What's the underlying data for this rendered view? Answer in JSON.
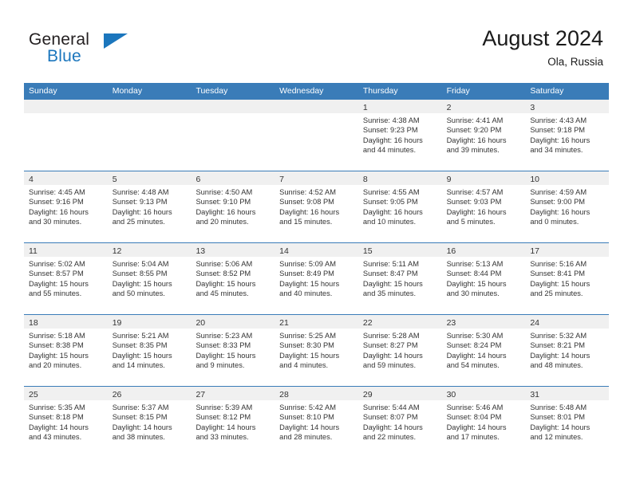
{
  "brand": {
    "name_part1": "General",
    "name_part2": "Blue",
    "flag_icon": "brand-flag-icon"
  },
  "header": {
    "title": "August 2024",
    "location": "Ola, Russia"
  },
  "weekday_headers": [
    "Sunday",
    "Monday",
    "Tuesday",
    "Wednesday",
    "Thursday",
    "Friday",
    "Saturday"
  ],
  "colors": {
    "header_blue": "#3a7cb8",
    "band_gray": "#f0f0f0",
    "brand_blue": "#1b76bd",
    "text": "#333333"
  },
  "weeks": [
    [
      {
        "empty": true
      },
      {
        "empty": true
      },
      {
        "empty": true
      },
      {
        "empty": true
      },
      {
        "day": "1",
        "sunrise": "Sunrise: 4:38 AM",
        "sunset": "Sunset: 9:23 PM",
        "daylight1": "Daylight: 16 hours",
        "daylight2": "and 44 minutes."
      },
      {
        "day": "2",
        "sunrise": "Sunrise: 4:41 AM",
        "sunset": "Sunset: 9:20 PM",
        "daylight1": "Daylight: 16 hours",
        "daylight2": "and 39 minutes."
      },
      {
        "day": "3",
        "sunrise": "Sunrise: 4:43 AM",
        "sunset": "Sunset: 9:18 PM",
        "daylight1": "Daylight: 16 hours",
        "daylight2": "and 34 minutes."
      }
    ],
    [
      {
        "day": "4",
        "sunrise": "Sunrise: 4:45 AM",
        "sunset": "Sunset: 9:16 PM",
        "daylight1": "Daylight: 16 hours",
        "daylight2": "and 30 minutes."
      },
      {
        "day": "5",
        "sunrise": "Sunrise: 4:48 AM",
        "sunset": "Sunset: 9:13 PM",
        "daylight1": "Daylight: 16 hours",
        "daylight2": "and 25 minutes."
      },
      {
        "day": "6",
        "sunrise": "Sunrise: 4:50 AM",
        "sunset": "Sunset: 9:10 PM",
        "daylight1": "Daylight: 16 hours",
        "daylight2": "and 20 minutes."
      },
      {
        "day": "7",
        "sunrise": "Sunrise: 4:52 AM",
        "sunset": "Sunset: 9:08 PM",
        "daylight1": "Daylight: 16 hours",
        "daylight2": "and 15 minutes."
      },
      {
        "day": "8",
        "sunrise": "Sunrise: 4:55 AM",
        "sunset": "Sunset: 9:05 PM",
        "daylight1": "Daylight: 16 hours",
        "daylight2": "and 10 minutes."
      },
      {
        "day": "9",
        "sunrise": "Sunrise: 4:57 AM",
        "sunset": "Sunset: 9:03 PM",
        "daylight1": "Daylight: 16 hours",
        "daylight2": "and 5 minutes."
      },
      {
        "day": "10",
        "sunrise": "Sunrise: 4:59 AM",
        "sunset": "Sunset: 9:00 PM",
        "daylight1": "Daylight: 16 hours",
        "daylight2": "and 0 minutes."
      }
    ],
    [
      {
        "day": "11",
        "sunrise": "Sunrise: 5:02 AM",
        "sunset": "Sunset: 8:57 PM",
        "daylight1": "Daylight: 15 hours",
        "daylight2": "and 55 minutes."
      },
      {
        "day": "12",
        "sunrise": "Sunrise: 5:04 AM",
        "sunset": "Sunset: 8:55 PM",
        "daylight1": "Daylight: 15 hours",
        "daylight2": "and 50 minutes."
      },
      {
        "day": "13",
        "sunrise": "Sunrise: 5:06 AM",
        "sunset": "Sunset: 8:52 PM",
        "daylight1": "Daylight: 15 hours",
        "daylight2": "and 45 minutes."
      },
      {
        "day": "14",
        "sunrise": "Sunrise: 5:09 AM",
        "sunset": "Sunset: 8:49 PM",
        "daylight1": "Daylight: 15 hours",
        "daylight2": "and 40 minutes."
      },
      {
        "day": "15",
        "sunrise": "Sunrise: 5:11 AM",
        "sunset": "Sunset: 8:47 PM",
        "daylight1": "Daylight: 15 hours",
        "daylight2": "and 35 minutes."
      },
      {
        "day": "16",
        "sunrise": "Sunrise: 5:13 AM",
        "sunset": "Sunset: 8:44 PM",
        "daylight1": "Daylight: 15 hours",
        "daylight2": "and 30 minutes."
      },
      {
        "day": "17",
        "sunrise": "Sunrise: 5:16 AM",
        "sunset": "Sunset: 8:41 PM",
        "daylight1": "Daylight: 15 hours",
        "daylight2": "and 25 minutes."
      }
    ],
    [
      {
        "day": "18",
        "sunrise": "Sunrise: 5:18 AM",
        "sunset": "Sunset: 8:38 PM",
        "daylight1": "Daylight: 15 hours",
        "daylight2": "and 20 minutes."
      },
      {
        "day": "19",
        "sunrise": "Sunrise: 5:21 AM",
        "sunset": "Sunset: 8:35 PM",
        "daylight1": "Daylight: 15 hours",
        "daylight2": "and 14 minutes."
      },
      {
        "day": "20",
        "sunrise": "Sunrise: 5:23 AM",
        "sunset": "Sunset: 8:33 PM",
        "daylight1": "Daylight: 15 hours",
        "daylight2": "and 9 minutes."
      },
      {
        "day": "21",
        "sunrise": "Sunrise: 5:25 AM",
        "sunset": "Sunset: 8:30 PM",
        "daylight1": "Daylight: 15 hours",
        "daylight2": "and 4 minutes."
      },
      {
        "day": "22",
        "sunrise": "Sunrise: 5:28 AM",
        "sunset": "Sunset: 8:27 PM",
        "daylight1": "Daylight: 14 hours",
        "daylight2": "and 59 minutes."
      },
      {
        "day": "23",
        "sunrise": "Sunrise: 5:30 AM",
        "sunset": "Sunset: 8:24 PM",
        "daylight1": "Daylight: 14 hours",
        "daylight2": "and 54 minutes."
      },
      {
        "day": "24",
        "sunrise": "Sunrise: 5:32 AM",
        "sunset": "Sunset: 8:21 PM",
        "daylight1": "Daylight: 14 hours",
        "daylight2": "and 48 minutes."
      }
    ],
    [
      {
        "day": "25",
        "sunrise": "Sunrise: 5:35 AM",
        "sunset": "Sunset: 8:18 PM",
        "daylight1": "Daylight: 14 hours",
        "daylight2": "and 43 minutes."
      },
      {
        "day": "26",
        "sunrise": "Sunrise: 5:37 AM",
        "sunset": "Sunset: 8:15 PM",
        "daylight1": "Daylight: 14 hours",
        "daylight2": "and 38 minutes."
      },
      {
        "day": "27",
        "sunrise": "Sunrise: 5:39 AM",
        "sunset": "Sunset: 8:12 PM",
        "daylight1": "Daylight: 14 hours",
        "daylight2": "and 33 minutes."
      },
      {
        "day": "28",
        "sunrise": "Sunrise: 5:42 AM",
        "sunset": "Sunset: 8:10 PM",
        "daylight1": "Daylight: 14 hours",
        "daylight2": "and 28 minutes."
      },
      {
        "day": "29",
        "sunrise": "Sunrise: 5:44 AM",
        "sunset": "Sunset: 8:07 PM",
        "daylight1": "Daylight: 14 hours",
        "daylight2": "and 22 minutes."
      },
      {
        "day": "30",
        "sunrise": "Sunrise: 5:46 AM",
        "sunset": "Sunset: 8:04 PM",
        "daylight1": "Daylight: 14 hours",
        "daylight2": "and 17 minutes."
      },
      {
        "day": "31",
        "sunrise": "Sunrise: 5:48 AM",
        "sunset": "Sunset: 8:01 PM",
        "daylight1": "Daylight: 14 hours",
        "daylight2": "and 12 minutes."
      }
    ]
  ]
}
